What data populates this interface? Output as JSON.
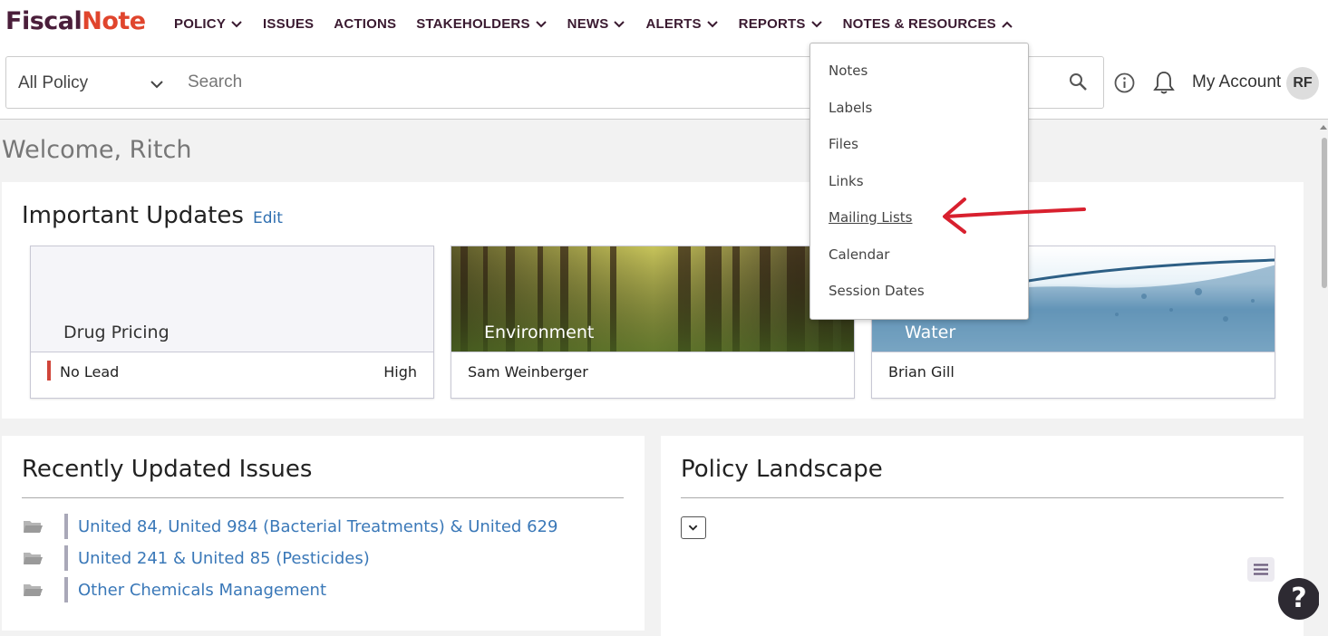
{
  "brand": {
    "part1": "Fiscal",
    "part2": "Note"
  },
  "nav": {
    "items": [
      {
        "label": "POLICY",
        "has_chevron": true
      },
      {
        "label": "ISSUES",
        "has_chevron": false
      },
      {
        "label": "ACTIONS",
        "has_chevron": false
      },
      {
        "label": "STAKEHOLDERS",
        "has_chevron": true
      },
      {
        "label": "NEWS",
        "has_chevron": true
      },
      {
        "label": "ALERTS",
        "has_chevron": true
      },
      {
        "label": "REPORTS",
        "has_chevron": true
      },
      {
        "label": "NOTES & RESOURCES",
        "has_chevron": true,
        "open": true
      }
    ]
  },
  "search": {
    "scope": "All Policy",
    "placeholder": "Search",
    "value": ""
  },
  "header": {
    "account_label": "My Account",
    "avatar_initials": "RF"
  },
  "welcome": "Welcome, Ritch",
  "important_updates": {
    "title": "Important Updates",
    "edit_label": "Edit",
    "cards": [
      {
        "title": "Drug Pricing",
        "lead": "No Lead",
        "priority": "High"
      },
      {
        "title": "Environment",
        "lead": "Sam Weinberger",
        "priority": ""
      },
      {
        "title": "Water",
        "lead": "Brian Gill",
        "priority": ""
      }
    ]
  },
  "recent_issues": {
    "title": "Recently Updated Issues",
    "items": [
      "United 84, United 984 (Bacterial Treatments) & United 629",
      "United 241 & United 85 (Pesticides)",
      "Other Chemicals Management"
    ]
  },
  "policy_landscape": {
    "title": "Policy Landscape"
  },
  "help_label": "?",
  "dropdown": {
    "items": [
      "Notes",
      "Labels",
      "Files",
      "Links",
      "Mailing Lists",
      "Calendar",
      "Session Dates"
    ],
    "hovered": "Mailing Lists"
  },
  "colors": {
    "brand_dark": "#4a1e3a",
    "brand_accent": "#e0452d",
    "link": "#3a78b8",
    "priority_high": "#d0453a",
    "annotation_arrow": "#d8202e"
  }
}
